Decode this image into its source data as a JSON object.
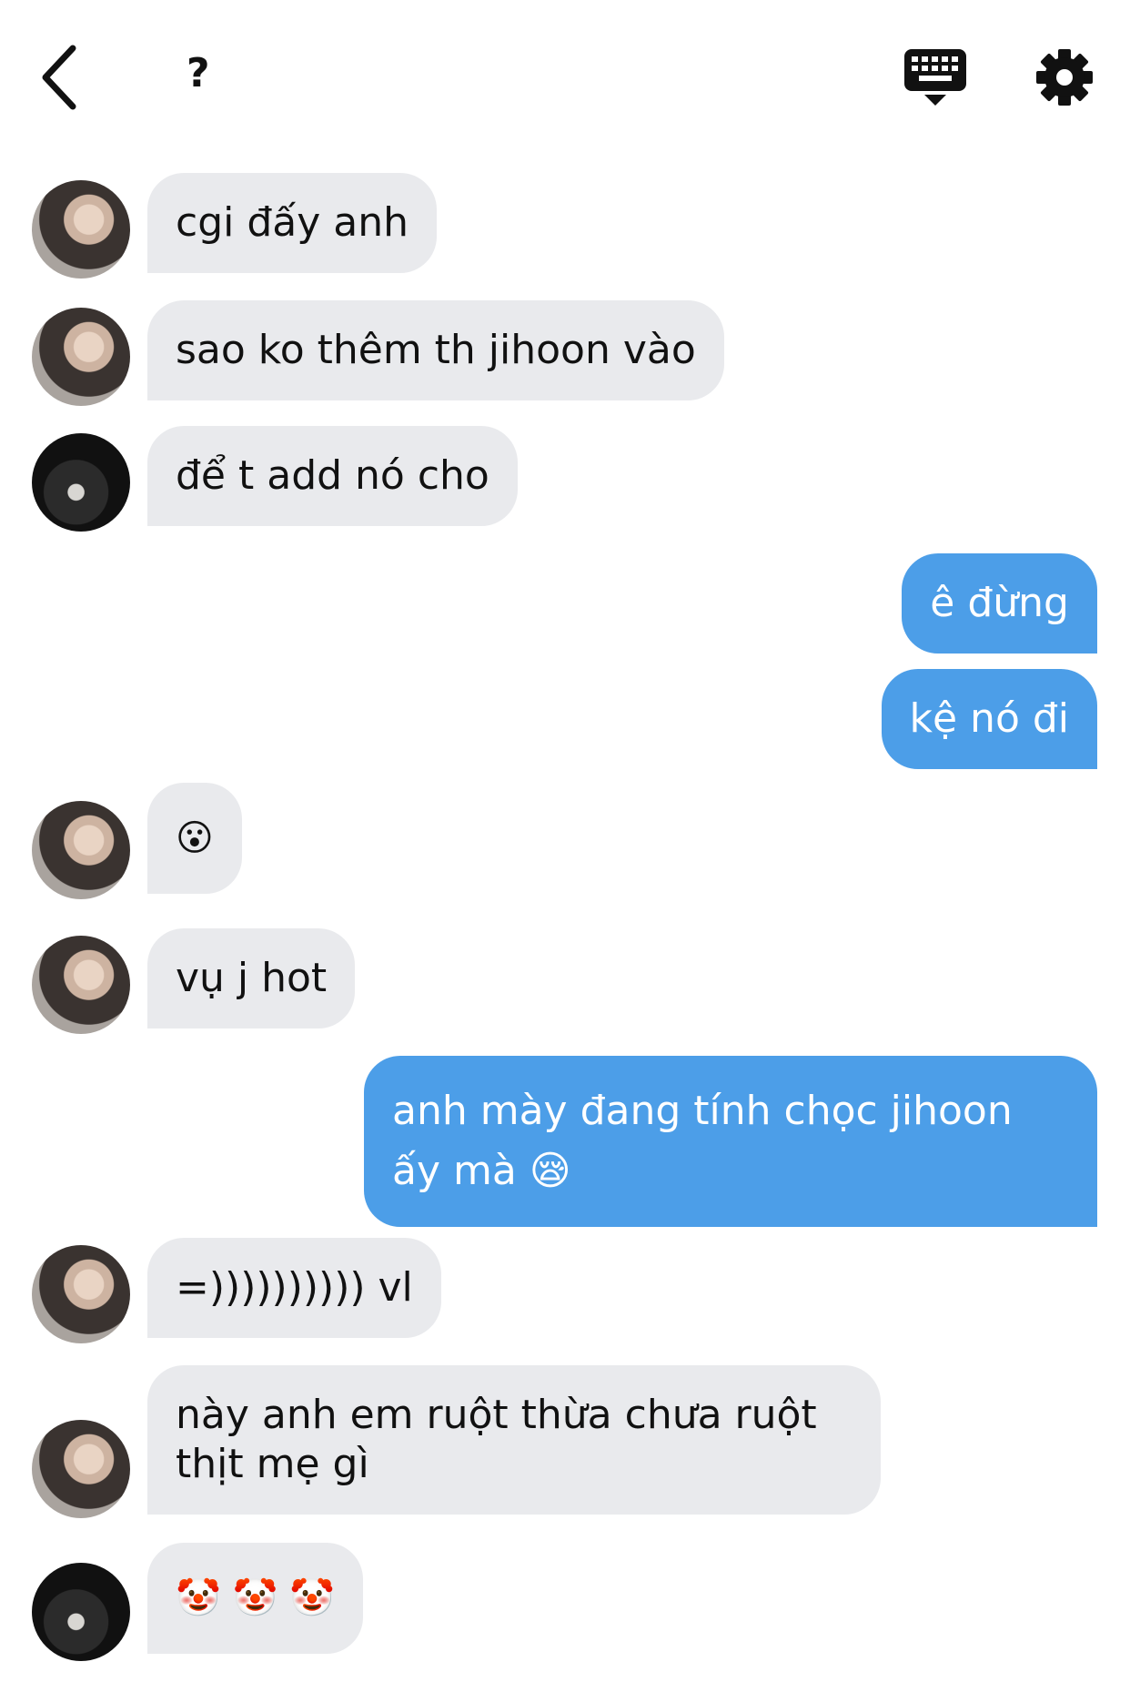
{
  "header": {
    "back_icon": "chevron-left-icon",
    "title": "?",
    "keyboard_icon": "keyboard-icon",
    "settings_icon": "gear-icon"
  },
  "messages": [
    {
      "from": "them",
      "avatar": "avatar-1",
      "text": "cgi đấy anh"
    },
    {
      "from": "them",
      "avatar": "avatar-1",
      "text": "sao ko thêm th jihoon vào"
    },
    {
      "from": "them",
      "avatar": "avatar-2",
      "text": "để t add nó cho"
    },
    {
      "from": "me",
      "text": "ê đừng"
    },
    {
      "from": "me",
      "text": "kệ nó đi"
    },
    {
      "from": "them",
      "avatar": "avatar-1",
      "text": "😮"
    },
    {
      "from": "them",
      "avatar": "avatar-1",
      "text": "vụ j hot"
    },
    {
      "from": "me",
      "text": "anh mày đang tính chọc jihoon ấy mà 😪"
    },
    {
      "from": "them",
      "avatar": "avatar-1",
      "text": "=)))))))))) vl"
    },
    {
      "from": "them",
      "avatar": "avatar-1",
      "text": "này anh em ruột thừa chưa ruột thịt mẹ gì"
    },
    {
      "from": "them",
      "avatar": "avatar-2",
      "text": "🤡 🤡 🤡"
    }
  ]
}
